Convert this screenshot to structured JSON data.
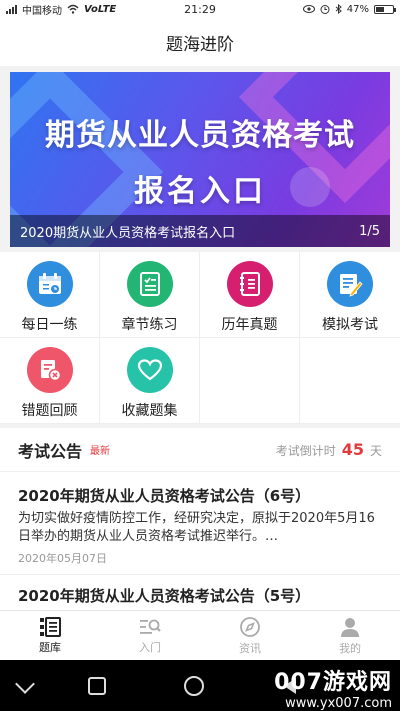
{
  "status_bar": {
    "carrier": "中国移动",
    "network": "VoLTE",
    "time": "21:29",
    "battery": "47%"
  },
  "header": {
    "title": "题海进阶"
  },
  "banner": {
    "line1": "期货从业人员资格考试",
    "line2": "报名入口",
    "caption": "2020期货从业人员资格考试报名入口",
    "pager": "1/5",
    "colors": {
      "start": "#2f74f0",
      "end": "#a23bd9"
    }
  },
  "grid": {
    "items": [
      {
        "label": "每日一练",
        "icon": "calendar-icon",
        "color": "#2f8fde"
      },
      {
        "label": "章节练习",
        "icon": "checklist-icon",
        "color": "#22b573"
      },
      {
        "label": "历年真题",
        "icon": "notebook-icon",
        "color": "#d6206f"
      },
      {
        "label": "模拟考试",
        "icon": "exam-paper-icon",
        "color": "#2f8fde"
      },
      {
        "label": "错题回顾",
        "icon": "wrong-question-icon",
        "color": "#f0566a"
      },
      {
        "label": "收藏题集",
        "icon": "heart-icon",
        "color": "#27c3a8"
      }
    ]
  },
  "notice": {
    "title": "考试公告",
    "badge": "最新",
    "countdown_label": "考试倒计时",
    "countdown_value": "45",
    "countdown_unit": "天",
    "articles": [
      {
        "title": "2020年期货从业人员资格考试公告（6号）",
        "summary": "为切实做好疫情防控工作，经研究决定，原拟于2020年5月16日举办的期货从业人员资格考试推迟举行。…",
        "date": "2020年05月07日"
      },
      {
        "title": "2020年期货从业人员资格考试公告（5号）"
      }
    ]
  },
  "tabbar": {
    "tabs": [
      {
        "label": "题库",
        "icon": "question-bank-icon",
        "active": true
      },
      {
        "label": "入门",
        "icon": "search-list-icon",
        "active": false
      },
      {
        "label": "资讯",
        "icon": "compass-icon",
        "active": false
      },
      {
        "label": "我的",
        "icon": "user-icon",
        "active": false
      }
    ]
  },
  "watermark": {
    "line1": "007游戏网",
    "line2": "www.yx007.com"
  }
}
